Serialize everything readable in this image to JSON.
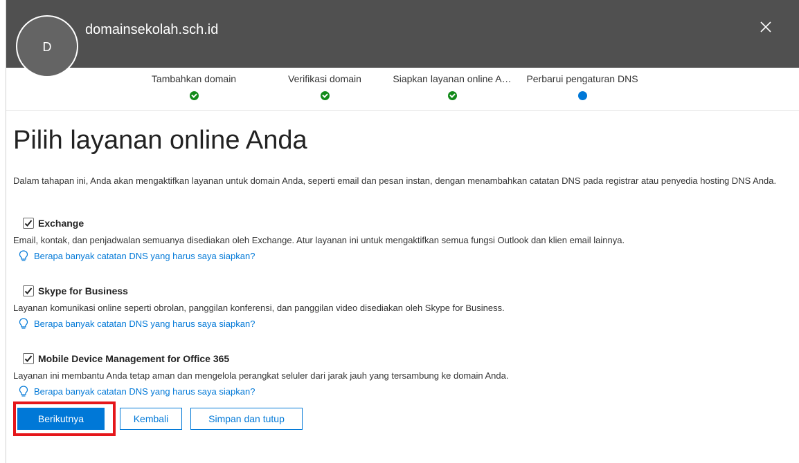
{
  "header": {
    "avatar_initial": "D",
    "domain": "domainsekolah.sch.id"
  },
  "steps": [
    {
      "label": "Tambahkan domain",
      "status": "done"
    },
    {
      "label": "Verifikasi domain",
      "status": "done"
    },
    {
      "label": "Siapkan layanan online A…",
      "status": "done"
    },
    {
      "label": "Perbarui pengaturan DNS",
      "status": "current"
    }
  ],
  "main": {
    "title": "Pilih layanan online Anda",
    "intro": "Dalam tahapan ini, Anda akan mengaktifkan layanan untuk domain Anda, seperti email dan pesan instan, dengan menambahkan catatan DNS pada registrar atau penyedia hosting DNS Anda."
  },
  "services": [
    {
      "name": "Exchange",
      "checked": true,
      "description": "Email, kontak, dan penjadwalan semuanya disediakan oleh Exchange. Atur layanan ini untuk mengaktifkan semua fungsi Outlook dan klien email lainnya.",
      "help_link": "Berapa banyak catatan DNS yang harus saya siapkan?"
    },
    {
      "name": "Skype for Business",
      "checked": true,
      "description": "Layanan komunikasi online seperti obrolan, panggilan konferensi, dan panggilan video disediakan oleh Skype for Business.",
      "help_link": "Berapa banyak catatan DNS yang harus saya siapkan?"
    },
    {
      "name": "Mobile Device Management for Office 365",
      "checked": true,
      "description": "Layanan ini membantu Anda tetap aman dan mengelola perangkat seluler dari jarak jauh yang tersambung ke domain Anda.",
      "help_link": "Berapa banyak catatan DNS yang harus saya siapkan?"
    }
  ],
  "buttons": {
    "next": "Berikutnya",
    "back": "Kembali",
    "save_close": "Simpan dan tutup"
  },
  "colors": {
    "header_bg": "#505050",
    "accent": "#0078d7",
    "done_green": "#128a1a",
    "highlight_red": "#e5161a"
  },
  "icons": {
    "close": "close-icon",
    "check": "checkmark-icon",
    "help": "lightbulb-icon"
  }
}
